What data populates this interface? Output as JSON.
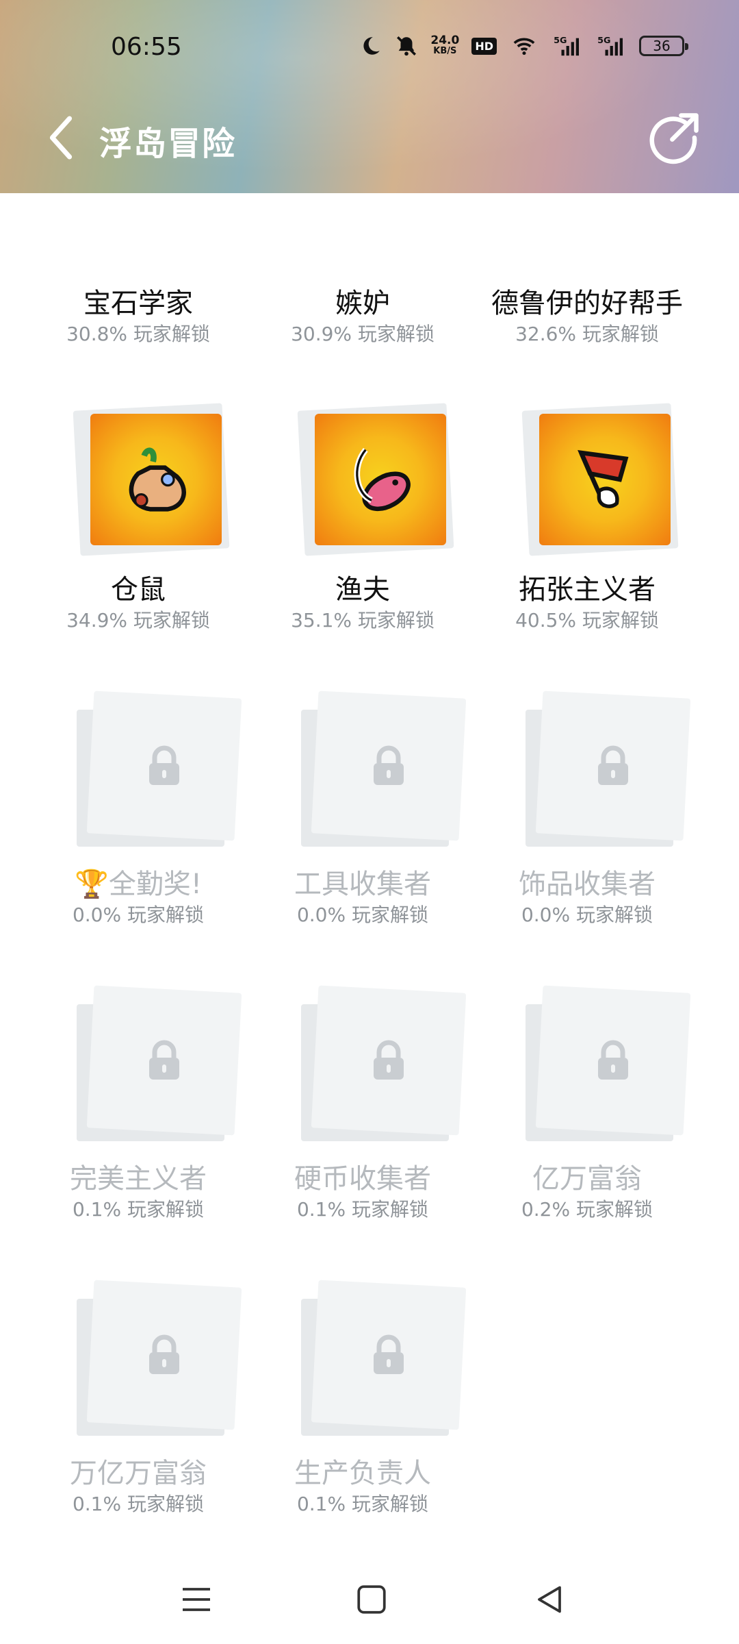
{
  "status_bar": {
    "time": "06:55",
    "speed_value": "24.0",
    "speed_unit": "KB/S",
    "hd_label": "HD",
    "battery": "36",
    "icons": [
      "moon-icon",
      "bell-off-icon",
      "hd-icon",
      "wifi-icon",
      "signal-5g-icon",
      "signal-5g-icon",
      "battery-icon"
    ]
  },
  "header": {
    "title": "浮岛冒险",
    "back_icon": "chevron-left-icon",
    "share_icon": "share-icon"
  },
  "achievements": [
    {
      "name": "宝石学家",
      "rate": "30.8% 玩家解锁",
      "locked": false,
      "icon": "gem-badge"
    },
    {
      "name": "嫉妒",
      "rate": "30.9% 玩家解锁",
      "locked": false,
      "icon": "green-badge"
    },
    {
      "name": "德鲁伊的好帮手",
      "rate": "32.6% 玩家解锁",
      "locked": false,
      "icon": "druid-badge"
    },
    {
      "name": "仓鼠",
      "rate": "34.9% 玩家解锁",
      "locked": false,
      "icon": "sack-badge"
    },
    {
      "name": "渔夫",
      "rate": "35.1% 玩家解锁",
      "locked": false,
      "icon": "fish-badge"
    },
    {
      "name": "拓张主义者",
      "rate": "40.5% 玩家解锁",
      "locked": false,
      "icon": "flag-badge"
    },
    {
      "name": "🏆全勤奖!",
      "rate": "0.0% 玩家解锁",
      "locked": true
    },
    {
      "name": "工具收集者",
      "rate": "0.0% 玩家解锁",
      "locked": true
    },
    {
      "name": "饰品收集者",
      "rate": "0.0% 玩家解锁",
      "locked": true
    },
    {
      "name": "完美主义者",
      "rate": "0.1% 玩家解锁",
      "locked": true
    },
    {
      "name": "硬币收集者",
      "rate": "0.1% 玩家解锁",
      "locked": true
    },
    {
      "name": "亿万富翁",
      "rate": "0.2% 玩家解锁",
      "locked": true
    },
    {
      "name": "万亿万富翁",
      "rate": "0.1% 玩家解锁",
      "locked": true
    },
    {
      "name": "生产负责人",
      "rate": "0.1% 玩家解锁",
      "locked": true
    }
  ],
  "bottom_nav": {
    "icons": [
      "menu-icon",
      "home-square-icon",
      "back-triangle-icon"
    ]
  },
  "colors": {
    "badge_gold": "#f7c21c",
    "badge_orange": "#f07c10",
    "locked_text": "#b5b9bd",
    "rate_text": "#8f9499"
  }
}
